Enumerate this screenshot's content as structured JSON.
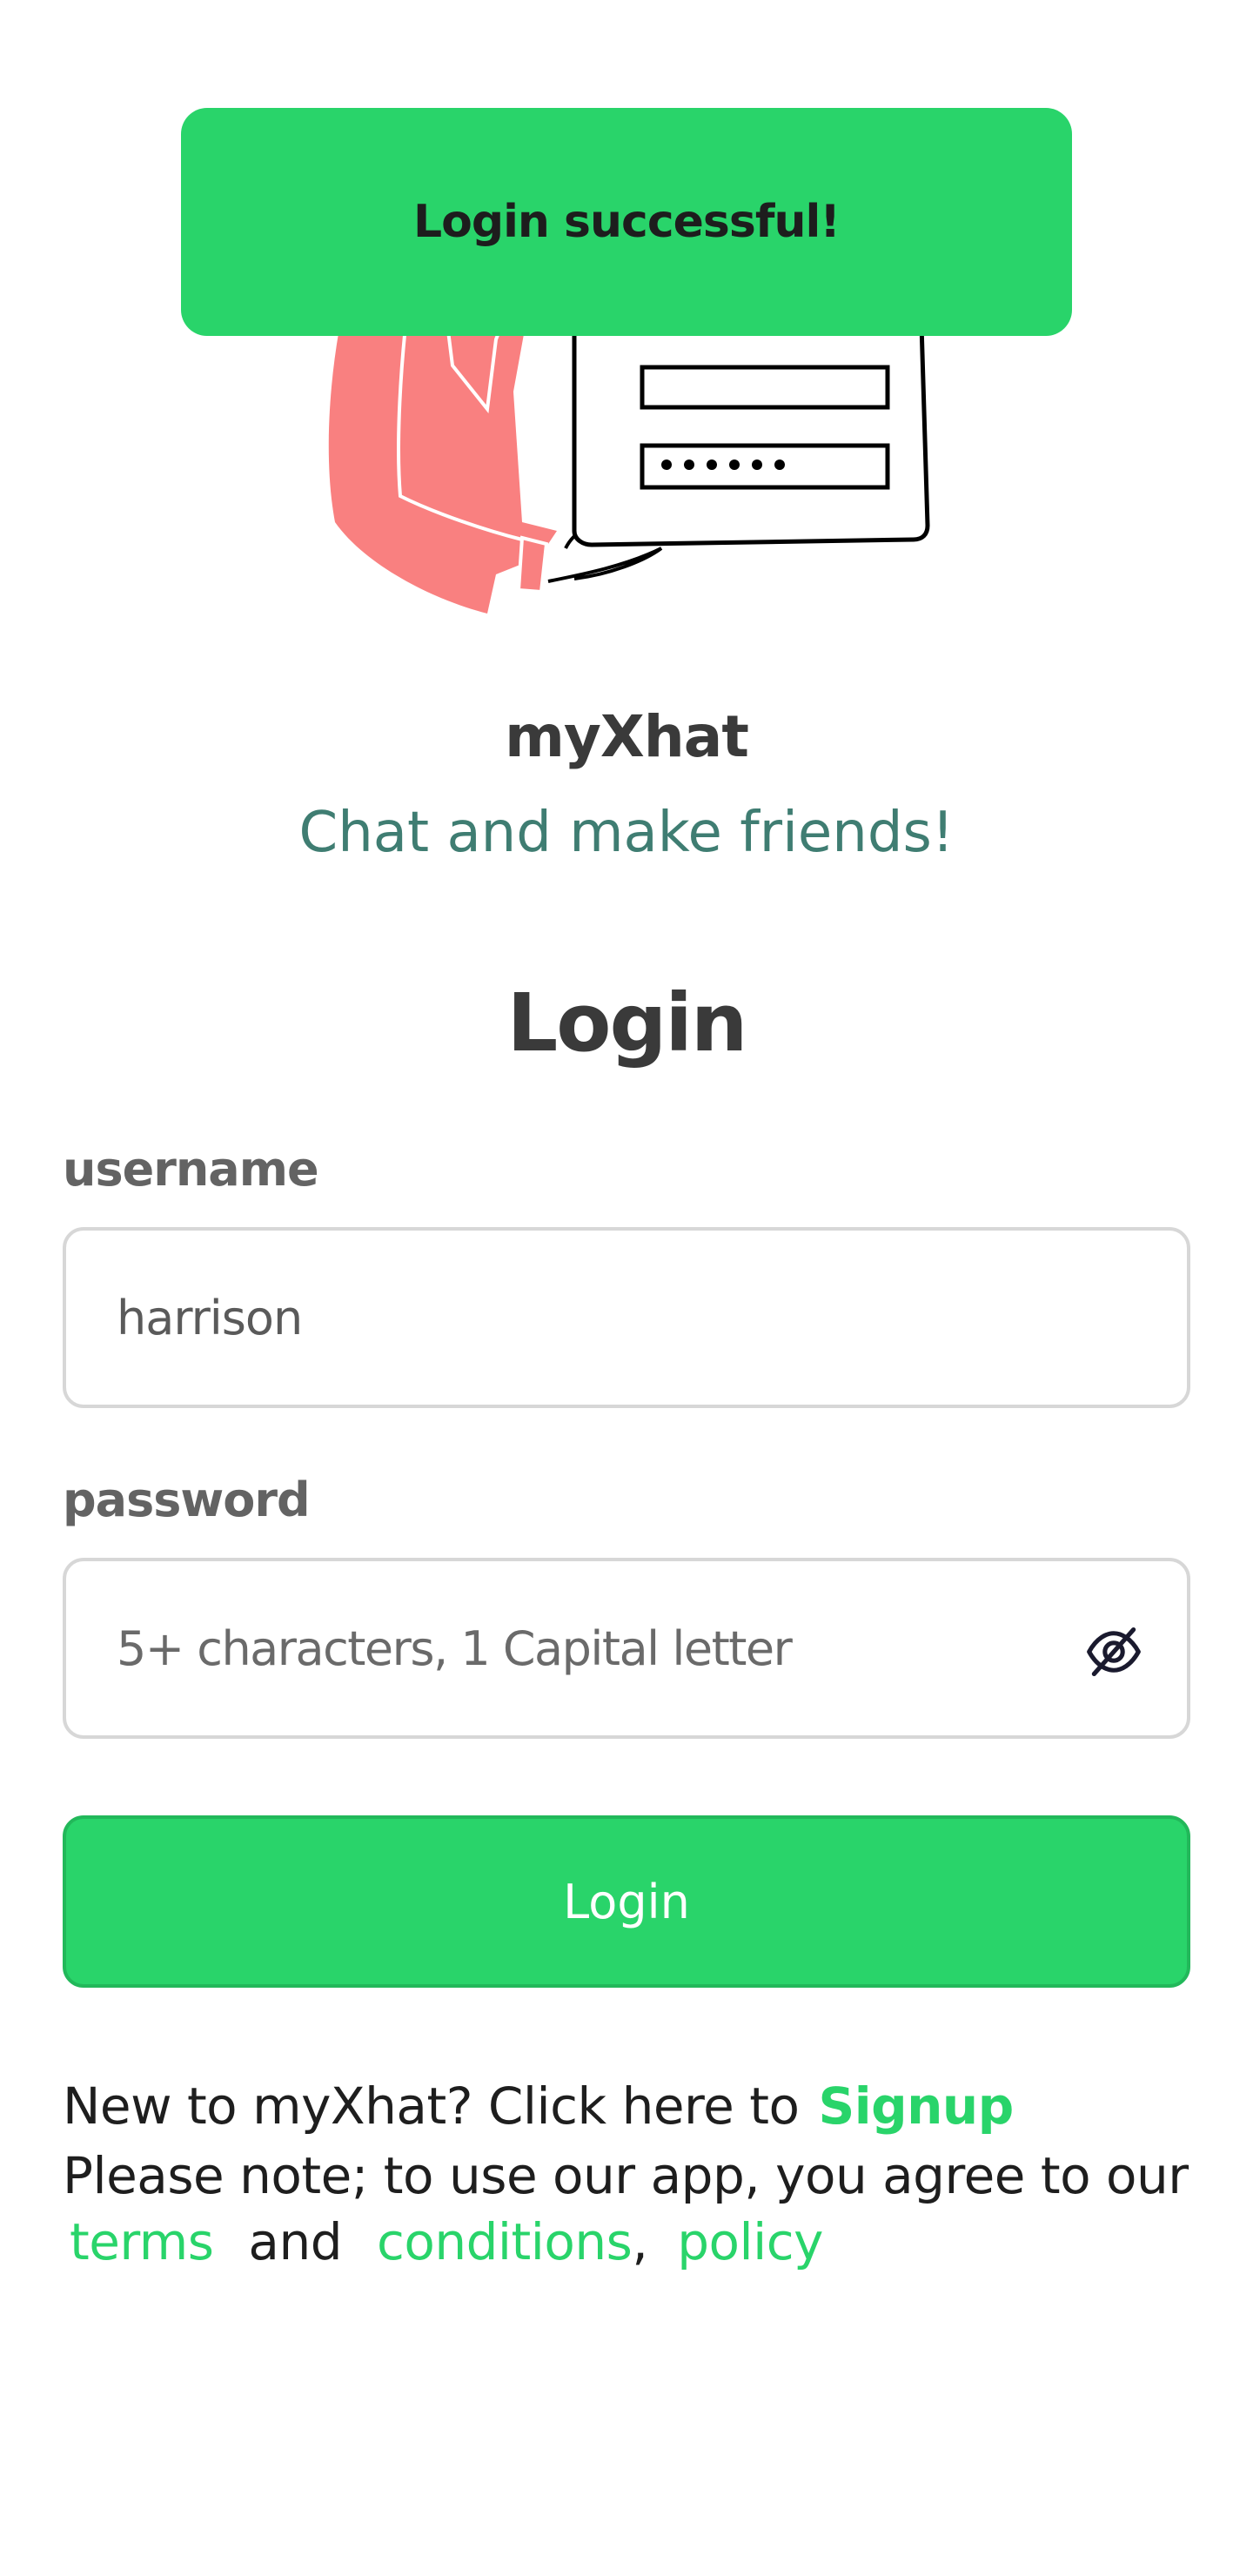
{
  "toast": {
    "message": "Login successful!"
  },
  "branding": {
    "app_name": "myXhat",
    "tagline": "Chat and make friends!"
  },
  "form": {
    "title": "Login",
    "username_label": "username",
    "username_value": "harrison",
    "password_label": "password",
    "password_placeholder": "5+ characters, 1 Capital letter",
    "password_toggle_icon": "eye-off-icon",
    "submit_label": "Login"
  },
  "footer": {
    "signup_prompt": "New to myXhat? Click here to",
    "signup_link": "Signup",
    "note": "Please note; to use our app, you agree to our",
    "terms_link": "terms",
    "and_text": "and",
    "conditions_link": "conditions",
    "comma": ",",
    "policy_link": "policy"
  },
  "colors": {
    "accent_green": "#29d46a",
    "tagline_teal": "#3f7d72",
    "illustration_red": "#f98080"
  }
}
